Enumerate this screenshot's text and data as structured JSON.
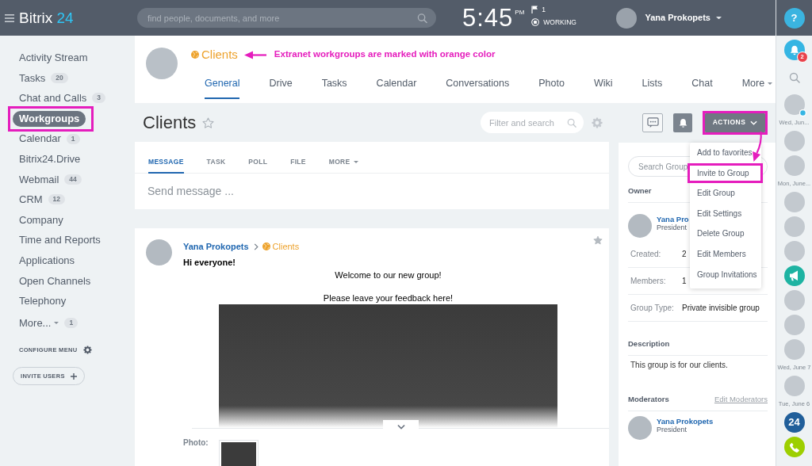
{
  "top_bar": {
    "logo": {
      "name": "Bitrix",
      "number": "24"
    },
    "search": {
      "placeholder": "find people, documents, and more"
    },
    "clock": {
      "time": "5:45",
      "period": "PM"
    },
    "flag_count": "1",
    "work_status": "WORKING",
    "user": {
      "name": "Yana Prokopets"
    }
  },
  "help_button": {
    "label": "?"
  },
  "sidebar": {
    "items": [
      {
        "label": "Activity Stream",
        "kind": "link",
        "selected": false,
        "highlighted": false
      },
      {
        "label": "Tasks",
        "count": "20",
        "kind": "link",
        "selected": false,
        "highlighted": false
      },
      {
        "label": "Chat and Calls",
        "count": "3",
        "kind": "link",
        "selected": false,
        "highlighted": false
      },
      {
        "label": "Workgroups",
        "kind": "link",
        "selected": true,
        "highlighted": true
      },
      {
        "label": "Calendar",
        "count": "1",
        "kind": "link",
        "selected": false,
        "highlighted": false
      },
      {
        "label": "Bitrix24.Drive",
        "kind": "link",
        "selected": false,
        "highlighted": false
      },
      {
        "label": "Webmail",
        "count": "44",
        "kind": "link",
        "selected": false,
        "highlighted": false
      },
      {
        "label": "CRM",
        "count": "12",
        "kind": "link",
        "selected": false,
        "highlighted": false
      },
      {
        "label": "Company",
        "kind": "link",
        "selected": false,
        "highlighted": false
      },
      {
        "label": "Time and Reports",
        "kind": "link",
        "selected": false,
        "highlighted": false
      },
      {
        "label": "Applications",
        "kind": "link",
        "selected": false,
        "highlighted": false
      },
      {
        "label": "Open Channels",
        "kind": "link",
        "selected": false,
        "highlighted": false
      },
      {
        "label": "Telephony",
        "kind": "link",
        "selected": false,
        "highlighted": false
      },
      {
        "label": "More...",
        "count": "1",
        "kind": "dropdown",
        "selected": false,
        "highlighted": false
      }
    ],
    "configure_label": "CONFIGURE MENU",
    "invite_button": "INVITE USERS"
  },
  "group_header": {
    "name": "Clients",
    "extranet": true,
    "annotation": "Extranet workgroups are marked with orange color",
    "tabs": [
      {
        "label": "General",
        "kind": "link",
        "selected": true
      },
      {
        "label": "Drive",
        "kind": "link",
        "selected": false
      },
      {
        "label": "Tasks",
        "kind": "link",
        "selected": false
      },
      {
        "label": "Calendar",
        "kind": "link",
        "selected": false
      },
      {
        "label": "Conversations",
        "kind": "link",
        "selected": false
      },
      {
        "label": "Photo",
        "kind": "link",
        "selected": false
      },
      {
        "label": "Wiki",
        "kind": "link",
        "selected": false
      },
      {
        "label": "Lists",
        "kind": "link",
        "selected": false
      },
      {
        "label": "Chat",
        "kind": "link",
        "selected": false
      },
      {
        "label": "More",
        "kind": "dropdown",
        "selected": false
      }
    ]
  },
  "page_title": {
    "text": "Clients",
    "favorite": false
  },
  "filter": {
    "placeholder": "Filter and search"
  },
  "toolbar": {
    "actions": {
      "label": "ACTIONS",
      "highlighted": true
    }
  },
  "actions_menu": {
    "items": [
      {
        "label": "Add to favorites",
        "highlighted": false
      },
      {
        "label": "Invite to Group",
        "highlighted": true
      },
      {
        "label": "Edit Group",
        "highlighted": false
      },
      {
        "label": "Edit Settings",
        "highlighted": false
      },
      {
        "label": "Delete Group",
        "highlighted": false
      },
      {
        "label": "Edit Members",
        "highlighted": false
      },
      {
        "label": "Group Invitations",
        "highlighted": false
      }
    ]
  },
  "post_form": {
    "tabs": [
      {
        "label": "MESSAGE",
        "kind": "link",
        "selected": true
      },
      {
        "label": "TASK",
        "kind": "link",
        "selected": false
      },
      {
        "label": "POLL",
        "kind": "link",
        "selected": false
      },
      {
        "label": "FILE",
        "kind": "link",
        "selected": false
      },
      {
        "label": "MORE",
        "kind": "dropdown",
        "selected": false
      }
    ],
    "placeholder": "Send message ..."
  },
  "post": {
    "author": "Yana Prokopets",
    "group": {
      "name": "Clients",
      "extranet": true
    },
    "title": "Hi everyone!",
    "lines": [
      "Welcome to our new group!",
      "Please leave your feedback here!"
    ],
    "attachment_label": "Photo:"
  },
  "group_info": {
    "search": {
      "placeholder": "Search Group"
    },
    "owner": {
      "title": "Owner",
      "name": "Yana Pro",
      "role": "President"
    },
    "details": [
      {
        "label": "Created:",
        "value": "2"
      },
      {
        "label": "Members:",
        "value": "1"
      },
      {
        "label": "Group Type:",
        "value": "Private invisible group"
      }
    ],
    "description": {
      "title": "Description",
      "text": "This group is for our clients."
    },
    "moderators": {
      "title": "Moderators",
      "edit_link": "Edit Moderators",
      "people": [
        {
          "name": "Yana Prokopets",
          "role": "President"
        }
      ]
    }
  },
  "right_rail": {
    "items": [
      {
        "kind": "notifications",
        "badge": "2"
      },
      {
        "kind": "search"
      },
      {
        "kind": "contact",
        "marked": true
      },
      {
        "kind": "date",
        "label": "Wed, Jun..."
      },
      {
        "kind": "contact",
        "marked": false
      },
      {
        "kind": "contact",
        "marked": false
      },
      {
        "kind": "date",
        "label": "Mon, June..."
      },
      {
        "kind": "contact",
        "marked": false
      },
      {
        "kind": "contact",
        "marked": false
      },
      {
        "kind": "contact",
        "marked": false
      },
      {
        "kind": "channel"
      },
      {
        "kind": "contact",
        "marked": false
      },
      {
        "kind": "contact",
        "marked": false
      },
      {
        "kind": "contact",
        "marked": false
      },
      {
        "kind": "date",
        "label": "Wed, June 7"
      },
      {
        "kind": "contact",
        "marked": false
      },
      {
        "kind": "date",
        "label": "Tue, June 6"
      },
      {
        "kind": "app",
        "label": "24"
      },
      {
        "kind": "call"
      }
    ]
  }
}
